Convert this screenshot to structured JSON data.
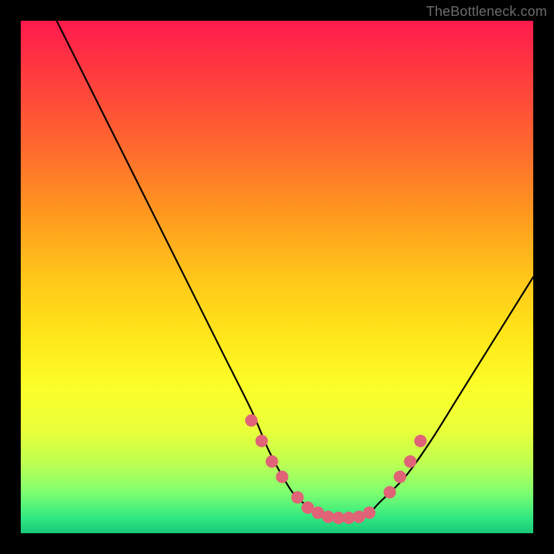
{
  "watermark": "TheBottleneck.com",
  "chart_data": {
    "type": "line",
    "title": "",
    "xlabel": "",
    "ylabel": "",
    "xlim": [
      0,
      100
    ],
    "ylim": [
      0,
      100
    ],
    "series": [
      {
        "name": "bottleneck-curve",
        "x": [
          7,
          10,
          15,
          20,
          25,
          30,
          35,
          40,
          45,
          48,
          50,
          53,
          55,
          58,
          60,
          63,
          65,
          68,
          70,
          75,
          80,
          85,
          90,
          95,
          100
        ],
        "values": [
          100,
          94,
          84,
          74,
          64,
          54,
          44,
          34,
          24,
          17,
          13,
          8,
          6,
          4,
          3,
          3,
          3,
          4,
          6,
          11,
          18,
          26,
          34,
          42,
          50
        ]
      }
    ],
    "markers": {
      "name": "highlight-points",
      "x": [
        45,
        47,
        49,
        51,
        54,
        56,
        58,
        60,
        62,
        64,
        66,
        68,
        72,
        74,
        76,
        78
      ],
      "values": [
        22,
        18,
        14,
        11,
        7,
        5,
        4,
        3.2,
        3,
        3,
        3.2,
        4,
        8,
        11,
        14,
        18
      ],
      "color": "#e06377",
      "radius": 9
    }
  }
}
